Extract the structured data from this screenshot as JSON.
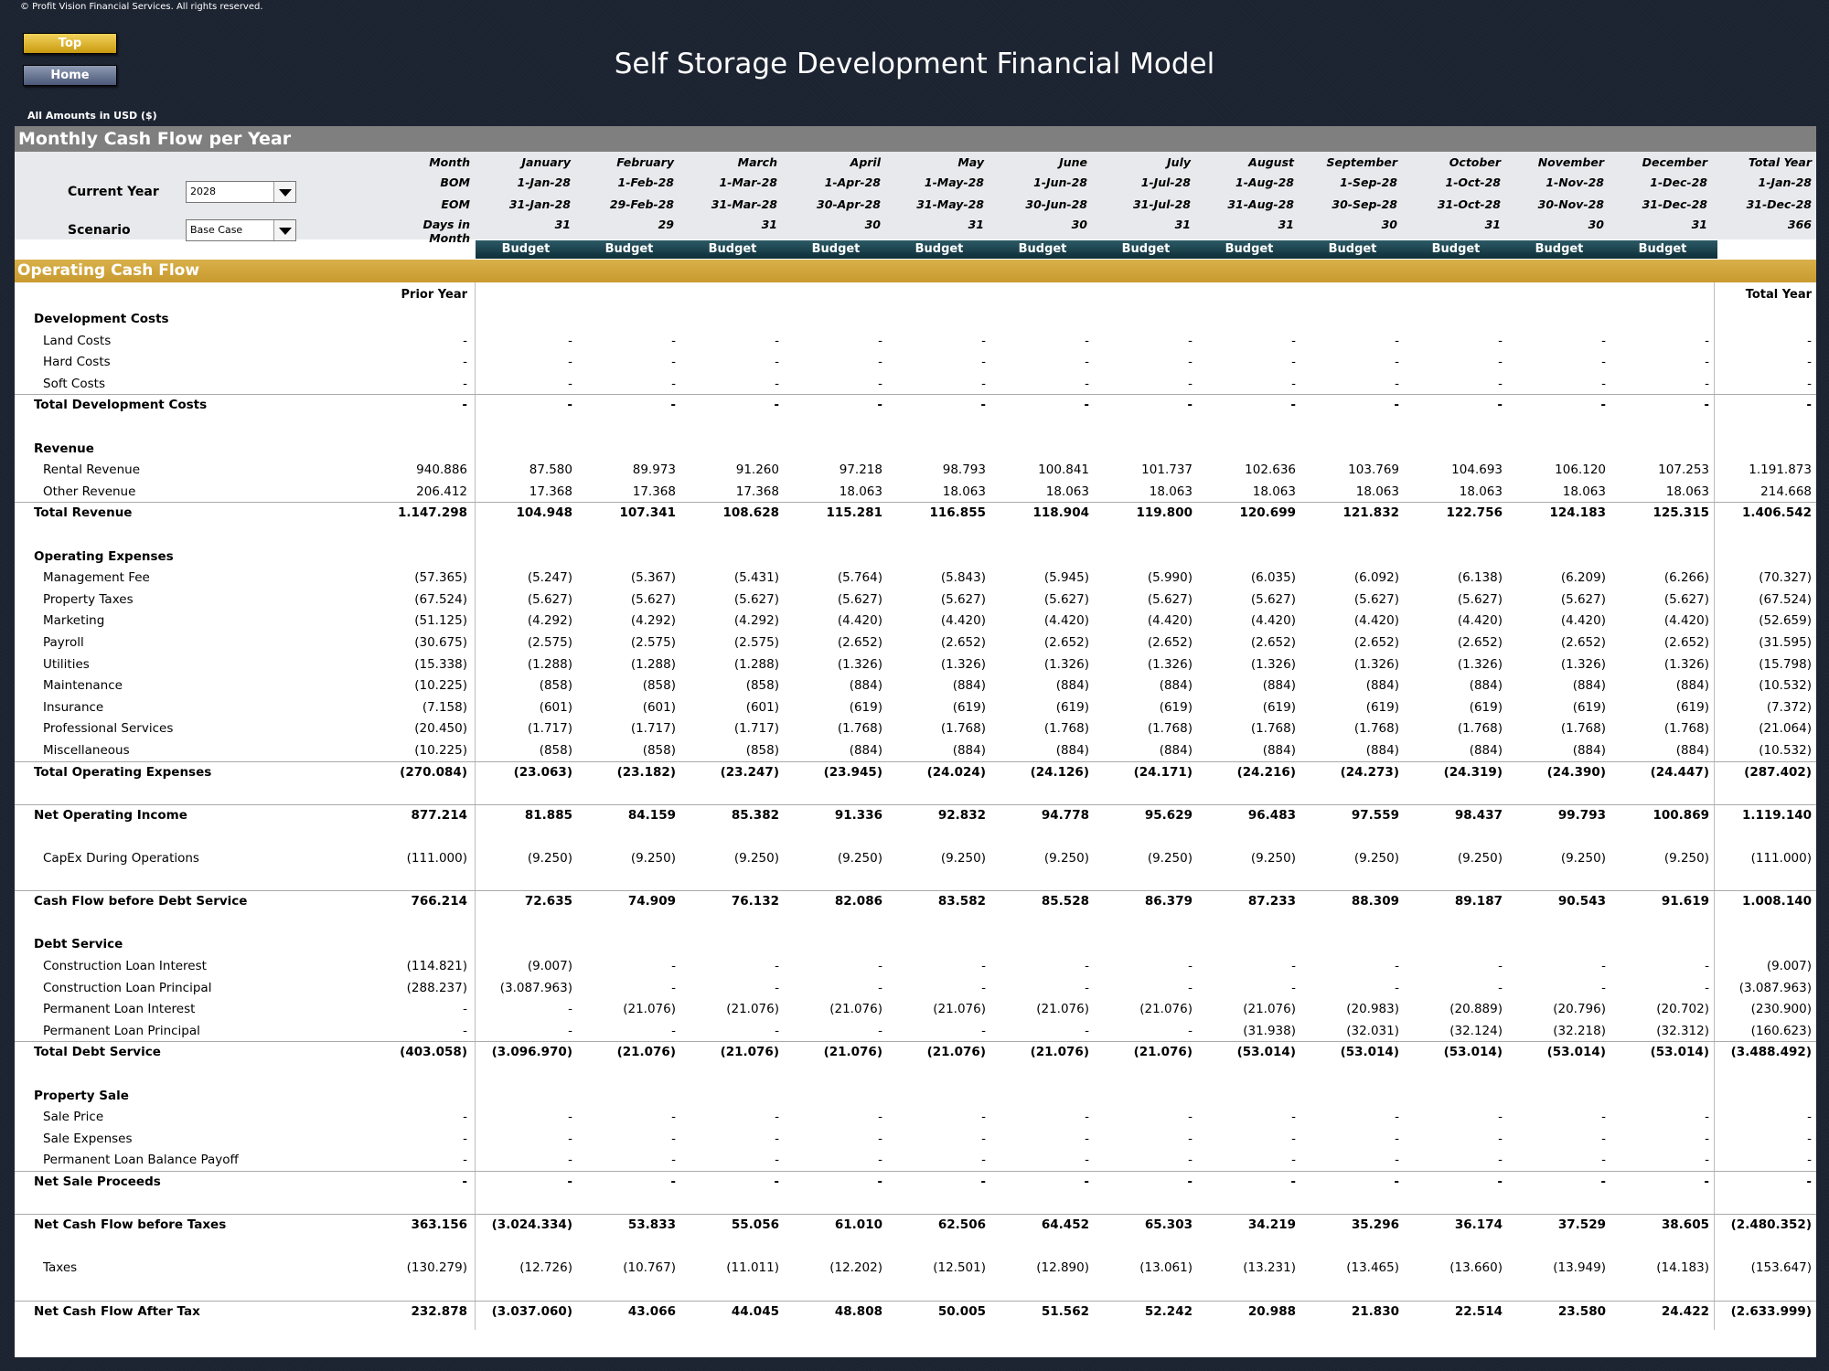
{
  "copyright": "© Profit Vision Financial Services. All rights reserved.",
  "nav": {
    "top_label": "Top",
    "home_label": "Home"
  },
  "title": "Self Storage Development Financial Model",
  "amounts_note": "All Amounts in  USD ($)",
  "section_title": "Monthly Cash Flow per Year",
  "section2_title": "Operating Cash Flow",
  "selectors": {
    "current_year_label": "Current Year",
    "current_year_value": "2028",
    "scenario_label": "Scenario",
    "scenario_value": "Base Case"
  },
  "header_labels": {
    "month": "Month",
    "bom": "BOM",
    "eom": "EOM",
    "days": "Days in Month"
  },
  "months": [
    {
      "name": "January",
      "bom": "1-Jan-28",
      "eom": "31-Jan-28",
      "days": "31",
      "tag": "Budget"
    },
    {
      "name": "February",
      "bom": "1-Feb-28",
      "eom": "29-Feb-28",
      "days": "29",
      "tag": "Budget"
    },
    {
      "name": "March",
      "bom": "1-Mar-28",
      "eom": "31-Mar-28",
      "days": "31",
      "tag": "Budget"
    },
    {
      "name": "April",
      "bom": "1-Apr-28",
      "eom": "30-Apr-28",
      "days": "30",
      "tag": "Budget"
    },
    {
      "name": "May",
      "bom": "1-May-28",
      "eom": "31-May-28",
      "days": "31",
      "tag": "Budget"
    },
    {
      "name": "June",
      "bom": "1-Jun-28",
      "eom": "30-Jun-28",
      "days": "30",
      "tag": "Budget"
    },
    {
      "name": "July",
      "bom": "1-Jul-28",
      "eom": "31-Jul-28",
      "days": "31",
      "tag": "Budget"
    },
    {
      "name": "August",
      "bom": "1-Aug-28",
      "eom": "31-Aug-28",
      "days": "31",
      "tag": "Budget"
    },
    {
      "name": "September",
      "bom": "1-Sep-28",
      "eom": "30-Sep-28",
      "days": "30",
      "tag": "Budget"
    },
    {
      "name": "October",
      "bom": "1-Oct-28",
      "eom": "31-Oct-28",
      "days": "31",
      "tag": "Budget"
    },
    {
      "name": "November",
      "bom": "1-Nov-28",
      "eom": "30-Nov-28",
      "days": "30",
      "tag": "Budget"
    },
    {
      "name": "December",
      "bom": "1-Dec-28",
      "eom": "31-Dec-28",
      "days": "31",
      "tag": "Budget"
    }
  ],
  "total_header": {
    "name": "Total Year",
    "bom": "1-Jan-28",
    "eom": "31-Dec-28",
    "days": "366"
  },
  "col_prior_year": "Prior Year",
  "col_total_year": "Total Year",
  "rows": [
    {
      "label": "Development Costs",
      "type": "header"
    },
    {
      "label": "Land Costs",
      "type": "item",
      "values": [
        "-",
        "-",
        "-",
        "-",
        "-",
        "-",
        "-",
        "-",
        "-",
        "-",
        "-",
        "-",
        "-",
        "-"
      ]
    },
    {
      "label": "Hard Costs",
      "type": "item",
      "values": [
        "-",
        "-",
        "-",
        "-",
        "-",
        "-",
        "-",
        "-",
        "-",
        "-",
        "-",
        "-",
        "-",
        "-"
      ]
    },
    {
      "label": "Soft Costs",
      "type": "item",
      "values": [
        "-",
        "-",
        "-",
        "-",
        "-",
        "-",
        "-",
        "-",
        "-",
        "-",
        "-",
        "-",
        "-",
        "-"
      ]
    },
    {
      "label": "Total Development Costs",
      "type": "total",
      "values": [
        "-",
        "-",
        "-",
        "-",
        "-",
        "-",
        "-",
        "-",
        "-",
        "-",
        "-",
        "-",
        "-",
        "-"
      ]
    },
    {
      "type": "blank"
    },
    {
      "label": "Revenue",
      "type": "header"
    },
    {
      "label": "Rental Revenue",
      "type": "item",
      "values": [
        "940.886",
        "87.580",
        "89.973",
        "91.260",
        "97.218",
        "98.793",
        "100.841",
        "101.737",
        "102.636",
        "103.769",
        "104.693",
        "106.120",
        "107.253",
        "1.191.873"
      ]
    },
    {
      "label": "Other Revenue",
      "type": "item",
      "values": [
        "206.412",
        "17.368",
        "17.368",
        "17.368",
        "18.063",
        "18.063",
        "18.063",
        "18.063",
        "18.063",
        "18.063",
        "18.063",
        "18.063",
        "18.063",
        "214.668"
      ]
    },
    {
      "label": "Total Revenue",
      "type": "total",
      "values": [
        "1.147.298",
        "104.948",
        "107.341",
        "108.628",
        "115.281",
        "116.855",
        "118.904",
        "119.800",
        "120.699",
        "121.832",
        "122.756",
        "124.183",
        "125.315",
        "1.406.542"
      ]
    },
    {
      "type": "blank"
    },
    {
      "label": "Operating Expenses",
      "type": "header"
    },
    {
      "label": "Management Fee",
      "type": "item",
      "values": [
        "(57.365)",
        "(5.247)",
        "(5.367)",
        "(5.431)",
        "(5.764)",
        "(5.843)",
        "(5.945)",
        "(5.990)",
        "(6.035)",
        "(6.092)",
        "(6.138)",
        "(6.209)",
        "(6.266)",
        "(70.327)"
      ]
    },
    {
      "label": "Property Taxes",
      "type": "item",
      "values": [
        "(67.524)",
        "(5.627)",
        "(5.627)",
        "(5.627)",
        "(5.627)",
        "(5.627)",
        "(5.627)",
        "(5.627)",
        "(5.627)",
        "(5.627)",
        "(5.627)",
        "(5.627)",
        "(5.627)",
        "(67.524)"
      ]
    },
    {
      "label": "Marketing",
      "type": "item",
      "values": [
        "(51.125)",
        "(4.292)",
        "(4.292)",
        "(4.292)",
        "(4.420)",
        "(4.420)",
        "(4.420)",
        "(4.420)",
        "(4.420)",
        "(4.420)",
        "(4.420)",
        "(4.420)",
        "(4.420)",
        "(52.659)"
      ]
    },
    {
      "label": "Payroll",
      "type": "item",
      "values": [
        "(30.675)",
        "(2.575)",
        "(2.575)",
        "(2.575)",
        "(2.652)",
        "(2.652)",
        "(2.652)",
        "(2.652)",
        "(2.652)",
        "(2.652)",
        "(2.652)",
        "(2.652)",
        "(2.652)",
        "(31.595)"
      ]
    },
    {
      "label": "Utilities",
      "type": "item",
      "values": [
        "(15.338)",
        "(1.288)",
        "(1.288)",
        "(1.288)",
        "(1.326)",
        "(1.326)",
        "(1.326)",
        "(1.326)",
        "(1.326)",
        "(1.326)",
        "(1.326)",
        "(1.326)",
        "(1.326)",
        "(15.798)"
      ]
    },
    {
      "label": "Maintenance",
      "type": "item",
      "values": [
        "(10.225)",
        "(858)",
        "(858)",
        "(858)",
        "(884)",
        "(884)",
        "(884)",
        "(884)",
        "(884)",
        "(884)",
        "(884)",
        "(884)",
        "(884)",
        "(10.532)"
      ]
    },
    {
      "label": "Insurance",
      "type": "item",
      "values": [
        "(7.158)",
        "(601)",
        "(601)",
        "(601)",
        "(619)",
        "(619)",
        "(619)",
        "(619)",
        "(619)",
        "(619)",
        "(619)",
        "(619)",
        "(619)",
        "(7.372)"
      ]
    },
    {
      "label": "Professional Services",
      "type": "item",
      "values": [
        "(20.450)",
        "(1.717)",
        "(1.717)",
        "(1.717)",
        "(1.768)",
        "(1.768)",
        "(1.768)",
        "(1.768)",
        "(1.768)",
        "(1.768)",
        "(1.768)",
        "(1.768)",
        "(1.768)",
        "(21.064)"
      ]
    },
    {
      "label": "Miscellaneous",
      "type": "item",
      "values": [
        "(10.225)",
        "(858)",
        "(858)",
        "(858)",
        "(884)",
        "(884)",
        "(884)",
        "(884)",
        "(884)",
        "(884)",
        "(884)",
        "(884)",
        "(884)",
        "(10.532)"
      ]
    },
    {
      "label": "Total Operating Expenses",
      "type": "total",
      "values": [
        "(270.084)",
        "(23.063)",
        "(23.182)",
        "(23.247)",
        "(23.945)",
        "(24.024)",
        "(24.126)",
        "(24.171)",
        "(24.216)",
        "(24.273)",
        "(24.319)",
        "(24.390)",
        "(24.447)",
        "(287.402)"
      ]
    },
    {
      "type": "blank"
    },
    {
      "label": "Net Operating Income",
      "type": "total",
      "values": [
        "877.214",
        "81.885",
        "84.159",
        "85.382",
        "91.336",
        "92.832",
        "94.778",
        "95.629",
        "96.483",
        "97.559",
        "98.437",
        "99.793",
        "100.869",
        "1.119.140"
      ]
    },
    {
      "type": "blank"
    },
    {
      "label": "CapEx During Operations",
      "type": "item",
      "values": [
        "(111.000)",
        "(9.250)",
        "(9.250)",
        "(9.250)",
        "(9.250)",
        "(9.250)",
        "(9.250)",
        "(9.250)",
        "(9.250)",
        "(9.250)",
        "(9.250)",
        "(9.250)",
        "(9.250)",
        "(111.000)"
      ]
    },
    {
      "type": "blank"
    },
    {
      "label": "Cash Flow before Debt Service",
      "type": "total",
      "values": [
        "766.214",
        "72.635",
        "74.909",
        "76.132",
        "82.086",
        "83.582",
        "85.528",
        "86.379",
        "87.233",
        "88.309",
        "89.187",
        "90.543",
        "91.619",
        "1.008.140"
      ]
    },
    {
      "type": "blank"
    },
    {
      "label": "Debt Service",
      "type": "header"
    },
    {
      "label": "Construction Loan Interest",
      "type": "item",
      "values": [
        "(114.821)",
        "(9.007)",
        "-",
        "-",
        "-",
        "-",
        "-",
        "-",
        "-",
        "-",
        "-",
        "-",
        "-",
        "(9.007)"
      ]
    },
    {
      "label": "Construction Loan Principal",
      "type": "item",
      "values": [
        "(288.237)",
        "(3.087.963)",
        "-",
        "-",
        "-",
        "-",
        "-",
        "-",
        "-",
        "-",
        "-",
        "-",
        "-",
        "(3.087.963)"
      ]
    },
    {
      "label": "Permanent Loan Interest",
      "type": "item",
      "values": [
        "-",
        "-",
        "(21.076)",
        "(21.076)",
        "(21.076)",
        "(21.076)",
        "(21.076)",
        "(21.076)",
        "(21.076)",
        "(20.983)",
        "(20.889)",
        "(20.796)",
        "(20.702)",
        "(230.900)"
      ]
    },
    {
      "label": "Permanent Loan Principal",
      "type": "item",
      "values": [
        "-",
        "-",
        "-",
        "-",
        "-",
        "-",
        "-",
        "-",
        "(31.938)",
        "(32.031)",
        "(32.124)",
        "(32.218)",
        "(32.312)",
        "(160.623)"
      ]
    },
    {
      "label": "Total Debt Service",
      "type": "total",
      "values": [
        "(403.058)",
        "(3.096.970)",
        "(21.076)",
        "(21.076)",
        "(21.076)",
        "(21.076)",
        "(21.076)",
        "(21.076)",
        "(53.014)",
        "(53.014)",
        "(53.014)",
        "(53.014)",
        "(53.014)",
        "(3.488.492)"
      ]
    },
    {
      "type": "blank"
    },
    {
      "label": "Property Sale",
      "type": "header"
    },
    {
      "label": "Sale Price",
      "type": "item",
      "values": [
        "-",
        "-",
        "-",
        "-",
        "-",
        "-",
        "-",
        "-",
        "-",
        "-",
        "-",
        "-",
        "-",
        "-"
      ]
    },
    {
      "label": "Sale Expenses",
      "type": "item",
      "values": [
        "-",
        "-",
        "-",
        "-",
        "-",
        "-",
        "-",
        "-",
        "-",
        "-",
        "-",
        "-",
        "-",
        "-"
      ]
    },
    {
      "label": "Permanent Loan Balance Payoff",
      "type": "item",
      "values": [
        "-",
        "-",
        "-",
        "-",
        "-",
        "-",
        "-",
        "-",
        "-",
        "-",
        "-",
        "-",
        "-",
        "-"
      ]
    },
    {
      "label": "Net Sale Proceeds",
      "type": "total",
      "values": [
        "-",
        "-",
        "-",
        "-",
        "-",
        "-",
        "-",
        "-",
        "-",
        "-",
        "-",
        "-",
        "-",
        "-"
      ]
    },
    {
      "type": "blank"
    },
    {
      "label": "Net Cash Flow before Taxes",
      "type": "total",
      "values": [
        "363.156",
        "(3.024.334)",
        "53.833",
        "55.056",
        "61.010",
        "62.506",
        "64.452",
        "65.303",
        "34.219",
        "35.296",
        "36.174",
        "37.529",
        "38.605",
        "(2.480.352)"
      ]
    },
    {
      "type": "blank"
    },
    {
      "label": "Taxes",
      "type": "item",
      "values": [
        "(130.279)",
        "(12.726)",
        "(10.767)",
        "(11.011)",
        "(12.202)",
        "(12.501)",
        "(12.890)",
        "(13.061)",
        "(13.231)",
        "(13.465)",
        "(13.660)",
        "(13.949)",
        "(14.183)",
        "(153.647)"
      ]
    },
    {
      "type": "blank"
    },
    {
      "label": "Net Cash Flow After Tax",
      "type": "total",
      "values": [
        "232.878",
        "(3.037.060)",
        "43.066",
        "44.045",
        "48.808",
        "50.005",
        "51.562",
        "52.242",
        "20.988",
        "21.830",
        "22.514",
        "23.580",
        "24.422",
        "(2.633.999)"
      ]
    }
  ]
}
